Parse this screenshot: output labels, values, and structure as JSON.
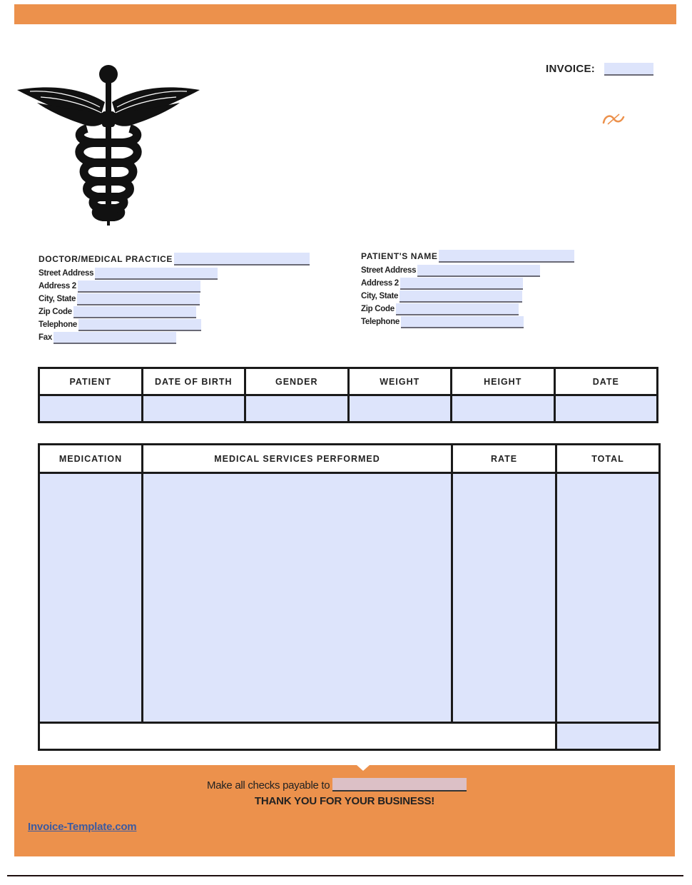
{
  "header": {
    "invoice_label": "INVOICE:",
    "invoice_number": "",
    "logo_icon": "caduceus-icon",
    "decorative_icon": "currency-swirl-icon"
  },
  "colors": {
    "accent": "#ec914c",
    "field_fill": "#dde4fb",
    "payable_field_fill": "#dcc0c6",
    "link": "#3c5aa0"
  },
  "doctor": {
    "title": "DOCTOR/MEDICAL PRACTICE",
    "fields": [
      {
        "label": "Street Address",
        "value": ""
      },
      {
        "label": "Address 2",
        "value": ""
      },
      {
        "label": "City, State",
        "value": ""
      },
      {
        "label": "Zip Code",
        "value": ""
      },
      {
        "label": "Telephone",
        "value": ""
      },
      {
        "label": "Fax",
        "value": ""
      }
    ],
    "name_value": ""
  },
  "patient": {
    "title": "PATIENT'S NAME",
    "fields": [
      {
        "label": "Street Address",
        "value": ""
      },
      {
        "label": "Address 2",
        "value": ""
      },
      {
        "label": "City, State",
        "value": ""
      },
      {
        "label": "Zip Code",
        "value": ""
      },
      {
        "label": "Telephone",
        "value": ""
      }
    ],
    "name_value": ""
  },
  "patient_table": {
    "headers": [
      "PATIENT",
      "DATE OF BIRTH",
      "GENDER",
      "WEIGHT",
      "HEIGHT",
      "DATE"
    ],
    "row": [
      "",
      "",
      "",
      "",
      "",
      ""
    ]
  },
  "services_table": {
    "headers": [
      "MEDICATION",
      "MEDICAL SERVICES PERFORMED",
      "RATE",
      "TOTAL"
    ],
    "row": [
      "",
      "",
      "",
      ""
    ],
    "grand_total": ""
  },
  "footer": {
    "payable_text": "Make all checks payable to",
    "payable_value": "",
    "thanks": "THANK YOU FOR YOUR BUSINESS!",
    "site_link": "Invoice-Template.com"
  }
}
